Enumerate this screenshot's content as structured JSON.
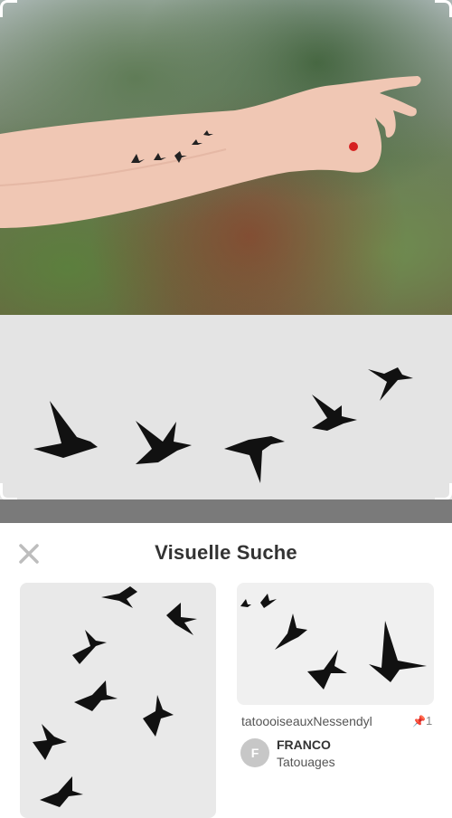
{
  "sheet": {
    "title": "Visuelle Suche",
    "close_icon": "close-icon"
  },
  "results": [
    {
      "description": "",
      "image": "flying-birds-silhouette"
    },
    {
      "description": "tatoooiseauxNessendyl",
      "repin_count": "1",
      "repin_icon": "pin-icon",
      "avatar_letter": "F",
      "author": "FRANCO",
      "board": "Tatouages",
      "image": "swallows-silhouette"
    }
  ],
  "colors": {
    "title": "#333333",
    "close_icon": "#bdbdbd",
    "sheet_bg": "#ffffff",
    "placeholder_bg": "#e9e9e9"
  }
}
